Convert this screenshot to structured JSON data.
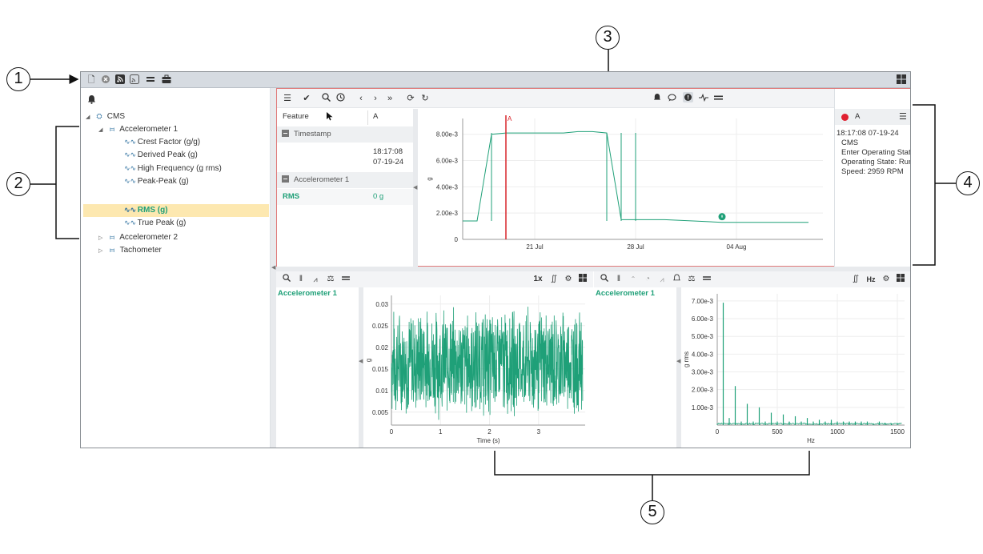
{
  "callouts": [
    "1",
    "2",
    "3",
    "4",
    "5"
  ],
  "topbar": {
    "icons": [
      "document-icon",
      "close-circle-icon",
      "rss-icon",
      "rss-square-icon",
      "equals-icon",
      "briefcase-icon"
    ],
    "right_icon": "grid-icon"
  },
  "tree": {
    "bell": "bell-icon",
    "root": "CMS",
    "accelerometer1": "Accelerometer 1",
    "features": [
      "Crest Factor (g/g)",
      "Derived Peak (g)",
      "High Frequency (g rms)",
      "Peak-Peak (g)",
      "RMS (g)",
      "True Peak (g)"
    ],
    "selected": "RMS (g)",
    "accelerometer2": "Accelerometer 2",
    "tachometer": "Tachometer"
  },
  "trend": {
    "toolbar_icons": [
      "menu-icon",
      "double-check-icon",
      "zoom-icon",
      "clock-icon",
      "chevron-left-icon",
      "chevron-right-icon",
      "double-chevron-right-icon",
      "sync-icon",
      "redo-icon"
    ],
    "center_icons": [
      "bell-icon",
      "comment-icon",
      "alert-icon",
      "pulse-icon",
      "equals-icon"
    ],
    "right_icons": [
      "bell-outline-icon",
      "filter-icon",
      "pause-icon",
      "chart-icon"
    ],
    "table": {
      "col_feature": "Feature",
      "col_a": "A",
      "section_timestamp": "Timestamp",
      "timestamp_time": "18:17:08",
      "timestamp_date": "07-19-24",
      "section_accel": "Accelerometer 1",
      "row_label": "RMS",
      "row_value": "0 g"
    },
    "cursor_label": "A"
  },
  "alarm": {
    "cursor": "A",
    "time": "18:17:08 07-19-24",
    "source": "CMS",
    "line1": "Enter Operating State",
    "line2": "Operating State: Run-",
    "line3": "Speed: 2959 RPM"
  },
  "waveform_panel": {
    "title": "Accelerometer 1",
    "left_icons": [
      "zoom-icon",
      "pause-icon",
      "chart-icon",
      "balance-icon",
      "equals-icon"
    ],
    "speed": "1x",
    "right_icons": [
      "integral-icon",
      "gear-icon",
      "grid-icon"
    ]
  },
  "spectrum_panel": {
    "title": "Accelerometer 1",
    "left_icons": [
      "zoom-icon",
      "pause-icon",
      "caret-up-icon",
      "gauge-icon",
      "chart-icon",
      "bell-outline-icon",
      "balance-icon",
      "equals-icon"
    ],
    "unit_btn": "Hz",
    "right_icons": [
      "integral-icon",
      "gear-icon",
      "grid-icon"
    ]
  },
  "chart_data": [
    {
      "type": "line",
      "x": [
        "2024-07-16",
        "2024-07-17",
        "2024-07-18",
        "2024-07-19",
        "2024-07-19",
        "2024-07-20",
        "2024-07-21",
        "2024-07-22",
        "2024-07-23",
        "2024-07-24",
        "2024-07-25",
        "2024-07-26",
        "2024-07-27",
        "2024-07-28",
        "2024-07-30",
        "2024-08-01",
        "2024-08-03",
        "2024-08-05",
        "2024-08-07",
        "2024-08-09"
      ],
      "values": [
        0.0014,
        0.0014,
        0.008,
        0.0081,
        0.0081,
        0.0081,
        0.0081,
        0.0081,
        0.0081,
        0.0082,
        0.0082,
        0.0081,
        0.0015,
        0.0015,
        0.0015,
        0.0014,
        0.0013,
        0.0013,
        0.0013,
        0.0013
      ],
      "xticks": [
        "21 Jul",
        "28 Jul",
        "04 Aug"
      ],
      "yticks": [
        "0",
        "2.00e-3",
        "4.00e-3",
        "6.00e-3",
        "8.00e-3"
      ],
      "ylabel": "g",
      "ylim": [
        0,
        0.0092
      ],
      "legend": "none"
    },
    {
      "type": "line",
      "x_range": [
        0,
        3.9
      ],
      "amplitude_range": [
        0.003,
        0.03
      ],
      "mean": 0.0165,
      "xticks": [
        "0",
        "1",
        "2",
        "3"
      ],
      "yticks": [
        "0.005",
        "0.01",
        "0.015",
        "0.02",
        "0.025",
        "0.03"
      ],
      "xlabel": "Time (s)",
      "ylabel": "g",
      "ylim": [
        0.002,
        0.032
      ],
      "xlim": [
        0,
        3.95
      ],
      "color": "#1fa078"
    },
    {
      "type": "bar",
      "frequencies": [
        50,
        100,
        150,
        200,
        250,
        300,
        350,
        400,
        450,
        500,
        550,
        600,
        650,
        700,
        750,
        800,
        850,
        900,
        950,
        1000,
        1050,
        1100,
        1150,
        1200,
        1250,
        1300,
        1350,
        1400,
        1450,
        1500
      ],
      "values": [
        0.0069,
        0.0004,
        0.0022,
        0.0002,
        0.0012,
        0.0002,
        0.001,
        0.0002,
        0.0007,
        0.0002,
        0.0006,
        0.0002,
        0.0005,
        0.0002,
        0.0004,
        0.0002,
        0.0003,
        0.0002,
        0.0003,
        0.0002,
        0.0002,
        0.0002,
        0.0002,
        0.0002,
        0.0002,
        0.0001,
        0.0002,
        0.0001,
        0.0001,
        0.0001
      ],
      "xticks": [
        "0",
        "500",
        "1000",
        "1500"
      ],
      "yticks": [
        "1.00e-3",
        "2.00e-3",
        "3.00e-3",
        "4.00e-3",
        "5.00e-3",
        "6.00e-3",
        "7.00e-3"
      ],
      "xlabel": "Hz",
      "ylabel": "g rms",
      "ylim": [
        0,
        0.0074
      ],
      "xlim": [
        0,
        1560
      ],
      "color": "#1fa078"
    }
  ]
}
